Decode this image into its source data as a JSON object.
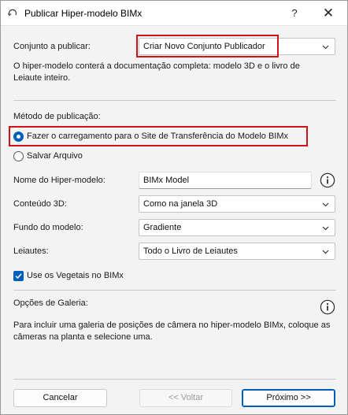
{
  "window": {
    "title": "Publicar Hiper-modelo BIMx",
    "help_label": "?",
    "close_label": "✕"
  },
  "set_to_publish": {
    "label": "Conjunto a publicar:",
    "value": "Criar Novo Conjunto Publicador"
  },
  "description": "O hiper-modelo conterá a documentação completa: modelo 3D e o livro de Leiaute inteiro.",
  "publishing_method": {
    "label": "Método de publicação:",
    "options": [
      {
        "label": "Fazer o carregamento para o Site de Transferência do Modelo BIMx",
        "selected": true
      },
      {
        "label": "Salvar Arquivo",
        "selected": false
      }
    ]
  },
  "hypermodel_name": {
    "label": "Nome do Hiper-modelo:",
    "value": "BIMx Model"
  },
  "content_3d": {
    "label": "Conteúdo 3D:",
    "value": "Como na janela 3D"
  },
  "model_background": {
    "label": "Fundo do modelo:",
    "value": "Gradiente"
  },
  "layouts": {
    "label": "Leiautes:",
    "value": "Todo o Livro de Leiautes"
  },
  "use_vegetation": {
    "label": "Use os Vegetais no BIMx",
    "checked": true
  },
  "gallery": {
    "label": "Opções de Galeria:",
    "description": "Para incluir uma galeria de posições de câmera no hiper-modelo BIMx, coloque as câmeras na planta e selecione uma."
  },
  "footer": {
    "cancel": "Cancelar",
    "back": "<< Voltar",
    "next": "Próximo >>"
  },
  "colors": {
    "accent": "#005fb8",
    "highlight": "#d0121b"
  },
  "icons": [
    "refresh-icon",
    "help-icon",
    "close-icon",
    "chevron-down-icon",
    "info-icon",
    "checkmark-icon"
  ]
}
